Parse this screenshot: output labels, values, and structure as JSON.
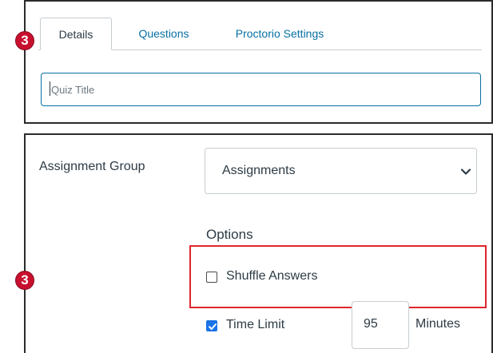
{
  "badges": {
    "top": "3",
    "bottom": "3"
  },
  "tabs": [
    {
      "label": "Details",
      "active": true
    },
    {
      "label": "Questions",
      "active": false
    },
    {
      "label": "Proctorio Settings",
      "active": false
    }
  ],
  "quiz_title": {
    "value": "",
    "placeholder": "Quiz Title"
  },
  "assignment_group": {
    "label": "Assignment Group",
    "selected": "Assignments"
  },
  "options": {
    "heading": "Options",
    "shuffle_answers": {
      "label": "Shuffle Answers",
      "checked": false
    },
    "time_limit": {
      "label": "Time Limit",
      "checked": true,
      "value": "95",
      "unit": "Minutes"
    }
  },
  "colors": {
    "accent": "#0770a3",
    "badge": "#c8102e",
    "highlight": "#e0262d",
    "checkbox": "#1a73e8"
  }
}
